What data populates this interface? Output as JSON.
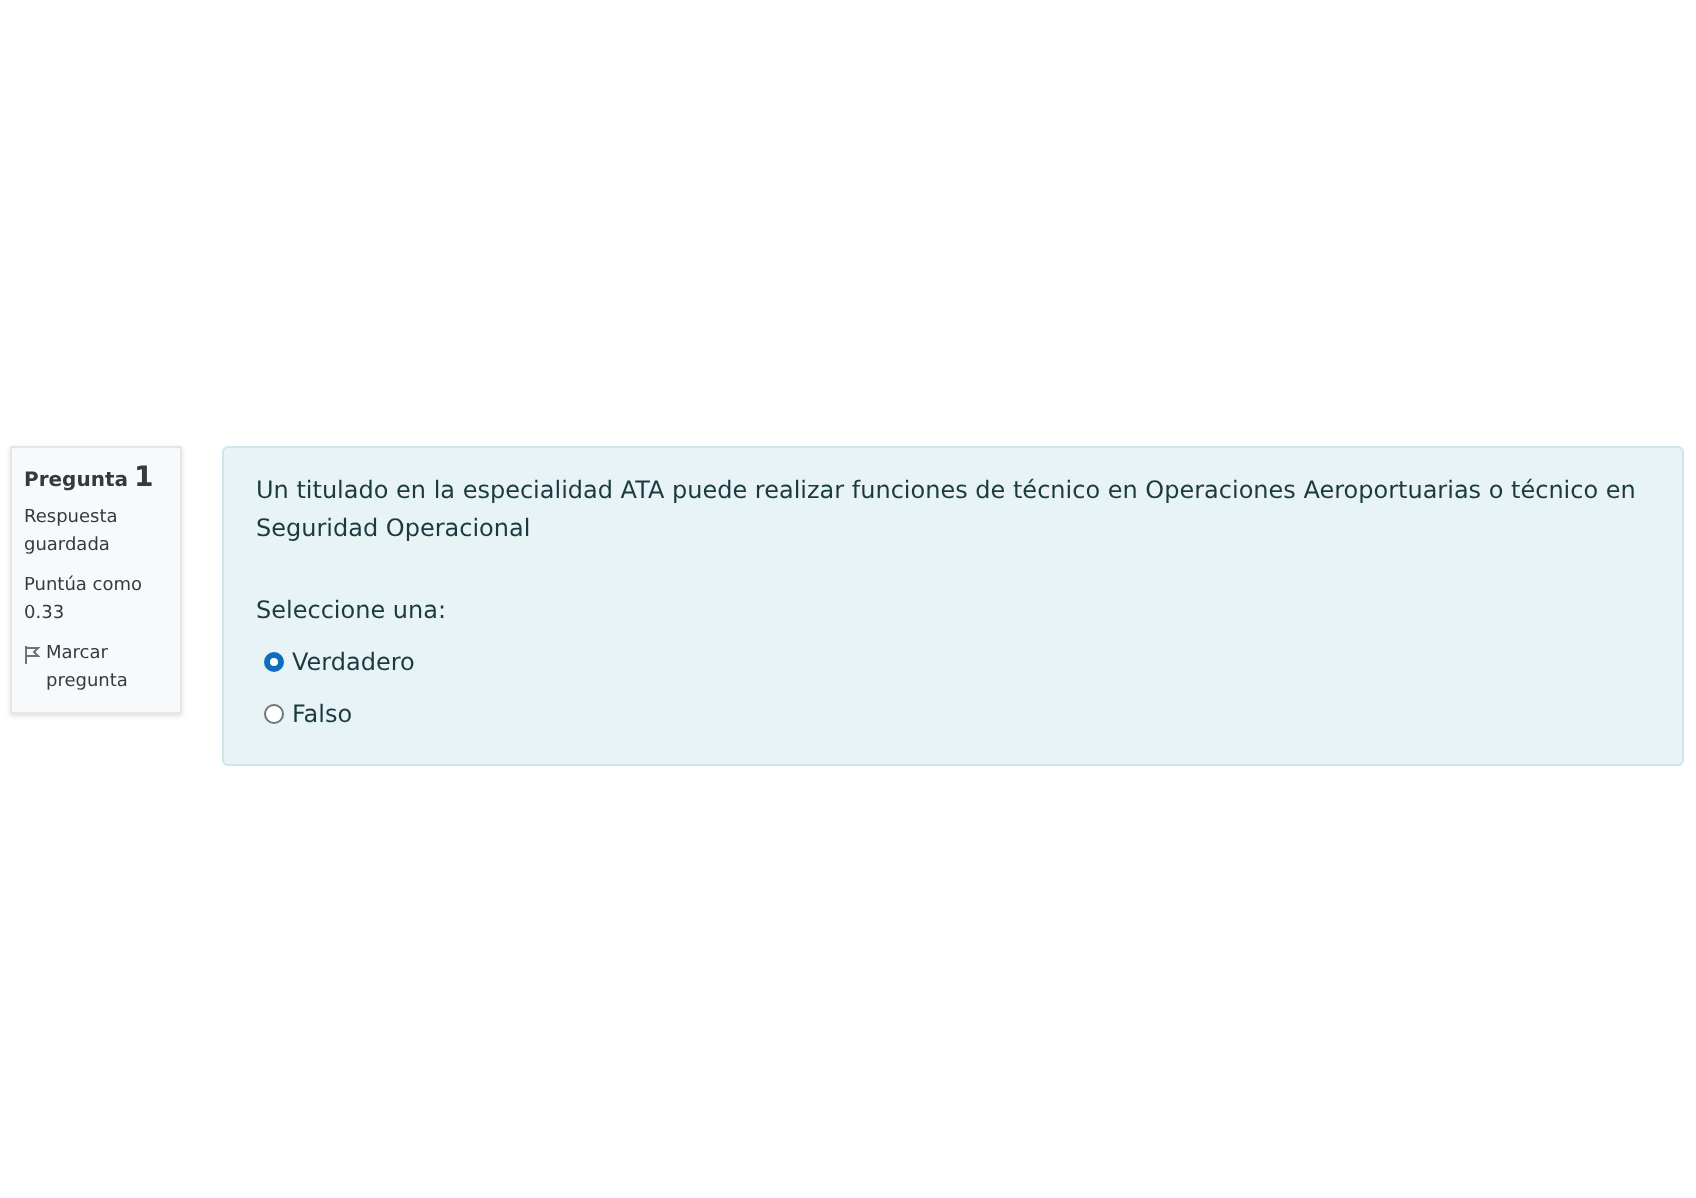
{
  "info": {
    "label": "Pregunta",
    "number": "1",
    "status": "Respuesta guardada",
    "grade": "Puntúa como 0.33",
    "flag": {
      "label": "Marcar pregunta",
      "flagged": false
    }
  },
  "question": {
    "text": "Un titulado en la especialidad ATA puede realizar funciones de técnico en Operaciones Aeroportuarias o técnico en Seguridad Operacional",
    "prompt": "Seleccione una:",
    "options": [
      {
        "label": "Verdadero",
        "selected": true
      },
      {
        "label": "Falso",
        "selected": false
      }
    ]
  }
}
